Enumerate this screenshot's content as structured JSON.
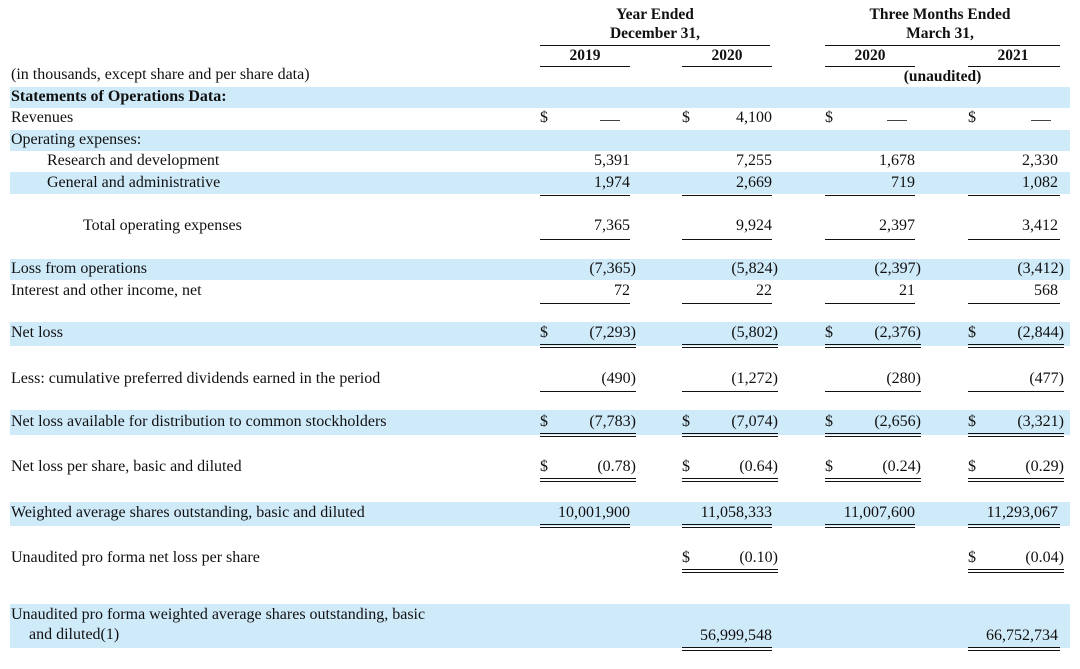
{
  "header": {
    "year_group": [
      "Year Ended",
      "December 31,"
    ],
    "quarter_group": [
      "Three Months Ended",
      "March 31,"
    ],
    "columns": [
      "2019",
      "2020",
      "2020",
      "2021"
    ],
    "unaudited": "(unaudited)",
    "note": "(in thousands, except share and per share data)"
  },
  "rows": [
    {
      "label": "Statements of Operations Data:",
      "values": [
        "",
        "",
        "",
        ""
      ]
    },
    {
      "label": "Revenues",
      "values": [
        "—",
        "4,100",
        "—",
        "—"
      ]
    },
    {
      "label": "Operating expenses:",
      "values": [
        "",
        "",
        "",
        ""
      ]
    },
    {
      "label": "Research and development",
      "values": [
        "5,391",
        "7,255",
        "1,678",
        "2,330"
      ]
    },
    {
      "label": "General and administrative",
      "values": [
        "1,974",
        "2,669",
        "719",
        "1,082"
      ]
    },
    {
      "label": "Total operating expenses",
      "values": [
        "7,365",
        "9,924",
        "2,397",
        "3,412"
      ]
    },
    {
      "label": "Loss from operations",
      "values": [
        "(7,365)",
        "(5,824)",
        "(2,397)",
        "(3,412)"
      ]
    },
    {
      "label": "Interest and other income, net",
      "values": [
        "72",
        "22",
        "21",
        "568"
      ]
    },
    {
      "label": "Net loss",
      "values": [
        "(7,293)",
        "(5,802)",
        "(2,376)",
        "(2,844)"
      ]
    },
    {
      "label": "Less: cumulative preferred dividends earned in the period",
      "values": [
        "(490)",
        "(1,272)",
        "(280)",
        "(477)"
      ]
    },
    {
      "label": "Net loss available for distribution to common stockholders",
      "values": [
        "(7,783)",
        "(7,074)",
        "(2,656)",
        "(3,321)"
      ]
    },
    {
      "label": "Net loss per share, basic and diluted",
      "values": [
        "(0.78)",
        "(0.64)",
        "(0.24)",
        "(0.29)"
      ]
    },
    {
      "label": "Weighted average shares outstanding, basic and diluted",
      "values": [
        "10,001,900",
        "11,058,333",
        "11,007,600",
        "11,293,067"
      ]
    },
    {
      "label": "Unaudited pro forma net loss per share",
      "values": [
        "",
        "(0.10)",
        "",
        "(0.04)"
      ]
    },
    {
      "label": "Unaudited pro forma weighted average shares outstanding, basic",
      "label2": "and diluted(1)",
      "values": [
        "",
        "56,999,548",
        "",
        "66,752,734"
      ]
    }
  ],
  "currency_symbol": "$"
}
